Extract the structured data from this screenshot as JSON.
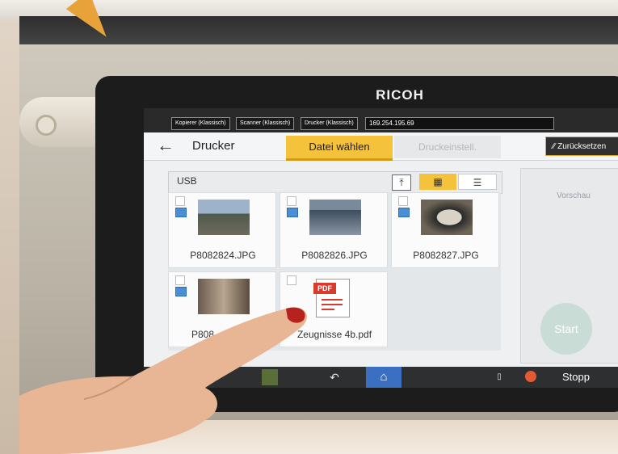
{
  "device": {
    "brand": "RICOH"
  },
  "statusbar": {
    "tabs": [
      "Kopierer (Klassisch)",
      "Scanner (Klassisch)",
      "Drucker (Klassisch)"
    ],
    "ip": "169.254.195.69"
  },
  "header": {
    "title": "Drucker",
    "tab_active": "Datei wählen",
    "tab_inactive": "Druckeinstell.",
    "reset_label": "Zurücksetzen"
  },
  "source": {
    "label": "USB"
  },
  "files": [
    {
      "name": "P8082824.JPG",
      "kind": "jpg"
    },
    {
      "name": "P8082826.JPG",
      "kind": "jpg"
    },
    {
      "name": "P8082827.JPG",
      "kind": "jpg"
    },
    {
      "name": "P808",
      "kind": "jpg"
    },
    {
      "name": "Zeugnisse 4b.pdf",
      "kind": "pdf"
    }
  ],
  "pdf_badge": "PDF",
  "preview": {
    "label": "Vorschau",
    "start_label": "Start"
  },
  "bottombar": {
    "stop_label": "Stopp"
  },
  "colors": {
    "accent": "#f5c23c",
    "home": "#3b6fc1",
    "stop": "#e15a34"
  }
}
